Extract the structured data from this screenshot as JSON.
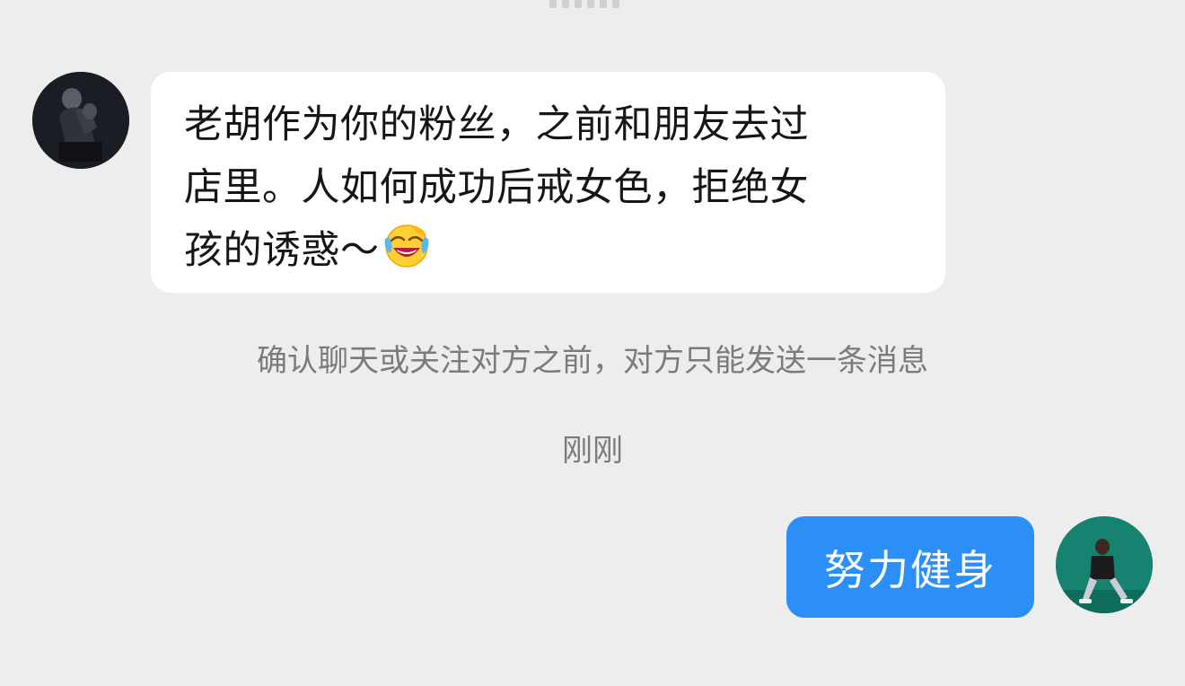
{
  "incoming_message": {
    "lines": [
      "老胡作为你的粉丝，之前和朋友去过",
      "店里。人如何成功后戒女色，拒绝女",
      "孩的诱惑～"
    ],
    "emoji": "laughing-crying-emoji"
  },
  "notice": {
    "text": "确认聊天或关注对方之前，对方只能发送一条消息"
  },
  "timestamp": {
    "text": "刚刚"
  },
  "outgoing_message": {
    "text": "努力健身"
  },
  "colors": {
    "background": "#ededed",
    "incoming_bubble": "#ffffff",
    "outgoing_bubble": "#2b8ff7",
    "system_text": "#7b7b7b"
  },
  "icons": {
    "sender_avatar": "avatar",
    "self_avatar": "avatar"
  }
}
